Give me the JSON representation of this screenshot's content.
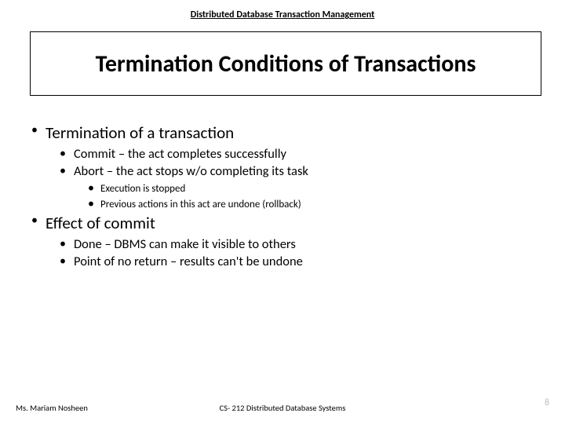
{
  "header": {
    "label": "Distributed Database Transaction Management"
  },
  "title": "Termination Conditions of Transactions",
  "bullets": [
    {
      "text": "Termination of a transaction",
      "children": [
        {
          "text": "Commit – the act completes successfully"
        },
        {
          "text": "Abort – the act stops w/o completing its task",
          "children": [
            {
              "text": "Execution is stopped"
            },
            {
              "text": "Previous actions in this act are undone (rollback)"
            }
          ]
        }
      ]
    },
    {
      "text": "Effect of commit",
      "children": [
        {
          "text": "Done – DBMS can make it visible to others"
        },
        {
          "text": "Point of no return – results can't be undone"
        }
      ]
    }
  ],
  "footer": {
    "left": "Ms. Mariam Nosheen",
    "center": "CS- 212 Distributed Database Systems",
    "right": "8"
  }
}
